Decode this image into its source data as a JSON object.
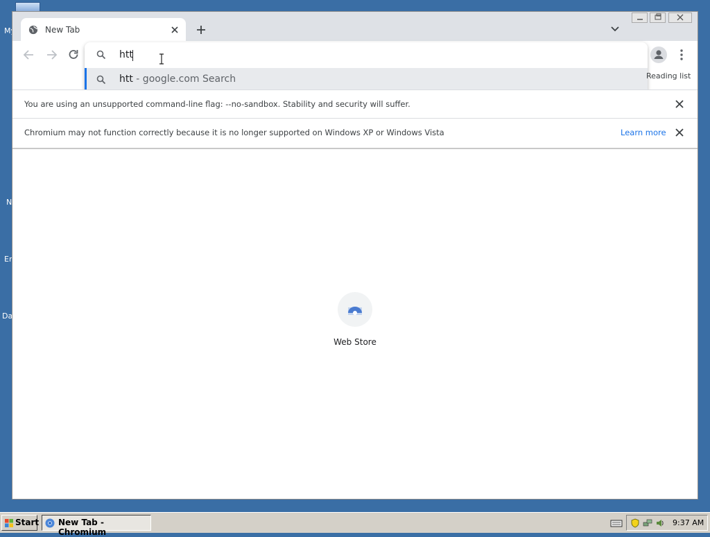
{
  "desktop": {
    "icon_labels": [
      "My",
      "N",
      "Er",
      "Da"
    ]
  },
  "tab": {
    "title": "New Tab"
  },
  "omnibox": {
    "value": "htt",
    "suggestion_query": "htt",
    "suggestion_suffix": " - google.com Search"
  },
  "toolbar": {
    "reading_list_label": "Reading list"
  },
  "infobars": [
    {
      "message": "You are using an unsupported command-line flag: --no-sandbox. Stability and security will suffer."
    },
    {
      "message": "Chromium may not function correctly because it is no longer supported on Windows XP or Windows Vista",
      "link": "Learn more"
    }
  ],
  "ntp": {
    "shortcut_label": "Web Store"
  },
  "taskbar": {
    "start_label": "Start",
    "task_label": "New Tab - Chromium",
    "clock": "9:37 AM"
  },
  "colors": {
    "desktop": "#3a6ea5",
    "accent": "#1a73e8",
    "tabstrip": "#dee1e6",
    "taskbar": "#d4d0c8"
  }
}
